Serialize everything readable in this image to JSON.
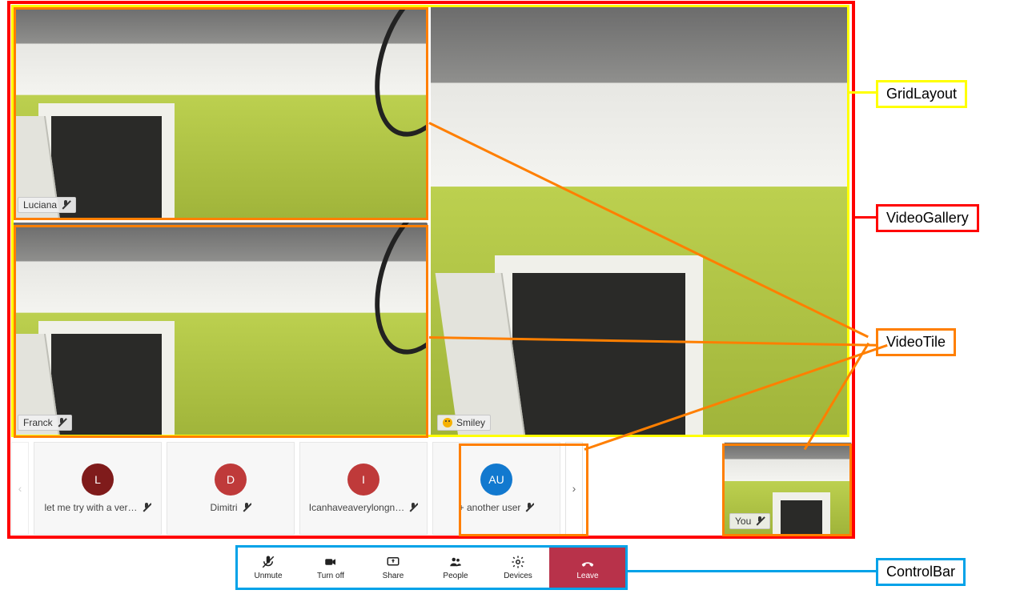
{
  "annotations": {
    "gridLayout": "GridLayout",
    "videoGallery": "VideoGallery",
    "videoTile": "VideoTile",
    "controlBar": "ControlBar"
  },
  "grid": {
    "tiles": [
      {
        "name": "Luciana",
        "muted": true
      },
      {
        "name": "Franck",
        "muted": true
      },
      {
        "name": "Smiley",
        "smiley": true
      }
    ]
  },
  "strip": {
    "items": [
      {
        "initial": "L",
        "label": "let me try with a ver…",
        "color": "darkred",
        "muted": true
      },
      {
        "initial": "D",
        "label": "Dimitri",
        "color": "red",
        "muted": true
      },
      {
        "initial": "I",
        "label": "Icanhaveaverylongn…",
        "color": "red",
        "muted": true
      },
      {
        "initial": "AU",
        "label": "+ another user",
        "color": "blue",
        "muted": true
      }
    ]
  },
  "pip": {
    "label": "You",
    "muted": true
  },
  "controls": {
    "unmute": "Unmute",
    "turnoff": "Turn off",
    "share": "Share",
    "people": "People",
    "devices": "Devices",
    "leave": "Leave"
  }
}
